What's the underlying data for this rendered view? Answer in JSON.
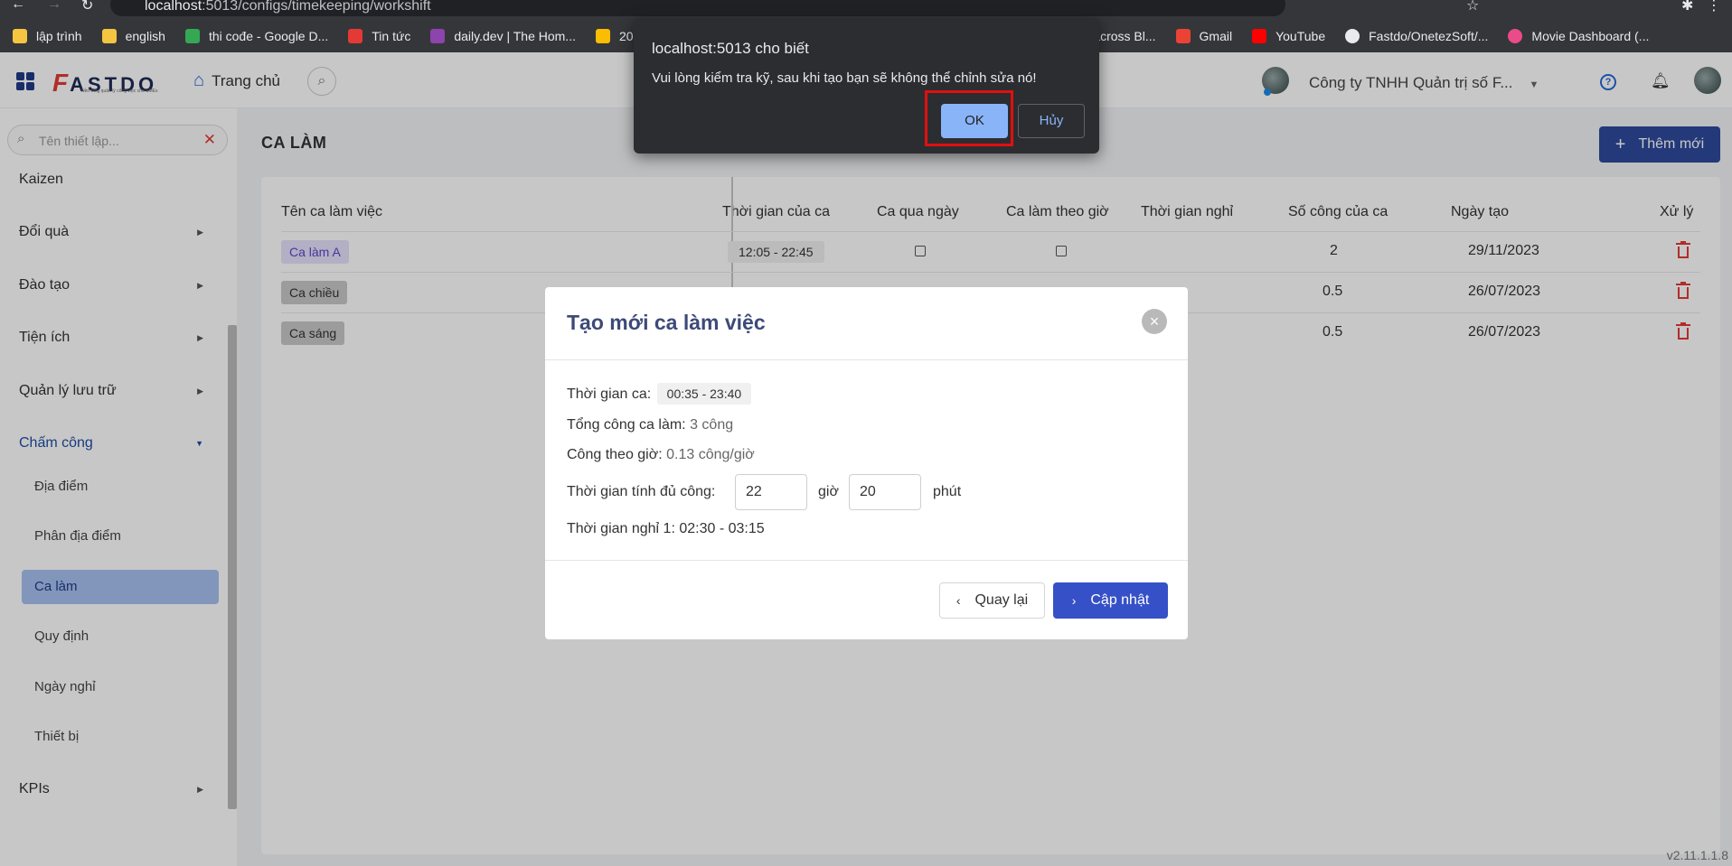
{
  "browser": {
    "url_host": "localhost",
    "url_rest": ":5013/configs/timekeeping/workshift",
    "bookmarks": [
      {
        "label": "lập trình",
        "color": "#f5c542"
      },
      {
        "label": "english",
        "color": "#f5c542"
      },
      {
        "label": "thi cođe - Google D...",
        "color": "#34a853"
      },
      {
        "label": "Tin tức",
        "color": "#e53935"
      },
      {
        "label": "daily.dev | The Hom...",
        "color": "#8e44ad"
      },
      {
        "label": "2023",
        "color": "#fbbc04"
      },
      {
        "label": "data across Bl...",
        "color": "#35363a"
      },
      {
        "label": "Gmail",
        "color": "#ea4335"
      },
      {
        "label": "YouTube",
        "color": "#ff0000"
      },
      {
        "label": "Fastdo/OnetezSoft/...",
        "color": "#e8eaed"
      },
      {
        "label": "Movie Dashboard (...",
        "color": "#ea4c89"
      }
    ]
  },
  "header": {
    "logo_rest": "ASTDO",
    "logo_f": "F",
    "logo_tagline": "Nền tảng quản lý công việc cho SMEs",
    "home_label": "Trang chủ",
    "company": "Công ty TNHH Quản trị số F..."
  },
  "sidebar": {
    "search_placeholder": "Tên thiết lập...",
    "items": [
      {
        "label": "Kaizen"
      },
      {
        "label": "Đổi quà"
      },
      {
        "label": "Đào tạo"
      },
      {
        "label": "Tiện ích"
      },
      {
        "label": "Quản lý lưu trữ"
      },
      {
        "label": "Chấm công"
      },
      {
        "label": "KPIs"
      }
    ],
    "sub_items": [
      {
        "label": "Địa điểm"
      },
      {
        "label": "Phân địa điểm"
      },
      {
        "label": "Ca làm"
      },
      {
        "label": "Quy định"
      },
      {
        "label": "Ngày nghỉ"
      },
      {
        "label": "Thiết bị"
      }
    ]
  },
  "main": {
    "title": "CA LÀM",
    "add_button": "Thêm mới",
    "columns": [
      "Tên ca làm việc",
      "Thời gian của ca",
      "Ca qua ngày",
      "Ca làm theo giờ",
      "Thời gian nghỉ",
      "Số công của ca",
      "Ngày tạo",
      "Xử lý"
    ],
    "rows": [
      {
        "name": "Ca làm A",
        "time": "12:05 - 22:45",
        "workdays": "2",
        "created": "29/11/2023"
      },
      {
        "name": "Ca chiều",
        "time": "",
        "workdays": "0.5",
        "created": "26/07/2023"
      },
      {
        "name": "Ca sáng",
        "time": "",
        "workdays": "0.5",
        "created": "26/07/2023"
      }
    ]
  },
  "modal": {
    "title": "Tạo mới ca làm việc",
    "shift_time_label": "Thời gian ca:",
    "shift_time_value": "00:35 - 23:40",
    "total_label": "Tổng công ca làm:",
    "total_value": "3 công",
    "hourly_label": "Công theo giờ:",
    "hourly_value": "0.13 công/giờ",
    "full_time_label": "Thời gian tính đủ công:",
    "hours_value": "22",
    "hours_unit": "giờ",
    "minutes_value": "20",
    "minutes_unit": "phút",
    "break_label": "Thời gian nghỉ 1: 02:30 - 03:15",
    "back_button": "Quay lại",
    "update_button": "Cập nhật"
  },
  "dialog": {
    "origin": "localhost:5013 cho biết",
    "message": "Vui lòng kiểm tra kỹ, sau khi tạo bạn sẽ không thể chỉnh sửa nó!",
    "ok": "OK",
    "cancel": "Hủy"
  },
  "version": "v2.11.1.1.8"
}
